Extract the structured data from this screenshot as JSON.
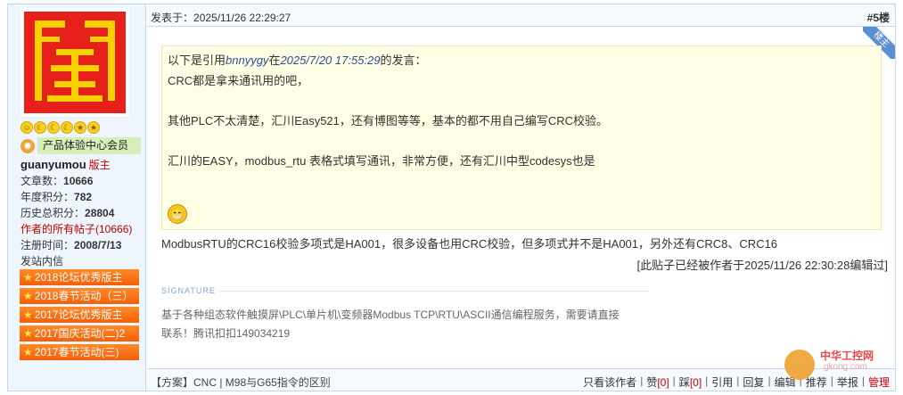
{
  "post": {
    "date_prefix": "发表于：",
    "date": "2025/11/26 22:29:27",
    "floor": "#5楼",
    "op_badge": "楼主"
  },
  "user": {
    "avatar_glyph": "闢",
    "stars": [
      "☺",
      "☾",
      "☾",
      "☾",
      "★",
      "★"
    ],
    "rank_label": "产品体验中心会员",
    "username": "guanyumou",
    "role": "版主",
    "stats": [
      {
        "label": "文章数：",
        "value": "10666"
      },
      {
        "label": "年度积分：",
        "value": "782"
      },
      {
        "label": "历史总积分：",
        "value": "28804"
      }
    ],
    "all_posts": "作者的所有帖子(10666)",
    "register_label": "注册时间：",
    "register_date": "2008/7/13",
    "msg_label": "发站内信",
    "medals": [
      "2018论坛优秀版主",
      "2018春节活动（三）",
      "2017论坛优秀版主",
      "2017国庆活动(二)2",
      "2017春节活动(三)"
    ]
  },
  "quote": {
    "prefix": "以下是引用",
    "author": "bnnyygy",
    "at": "在",
    "time": "2025/7/20 17:55:29",
    "suffix": "的发言：",
    "lines": [
      "CRC都是拿来通讯用的吧，",
      "其他PLC不太清楚，汇川Easy521，还有博图等等，基本的都不用自己编写CRC校验。",
      "汇川的EASY，modbus_rtu 表格式填写通讯，非常方便，还有汇川中型codesys也是"
    ],
    "emoji": "grin-emoji"
  },
  "body": {
    "text": "ModbusRTU的CRC16校验多项式是HA001，很多设备也用CRC校验，但多项式并不是HA001，另外还有CRC8、CRC16",
    "edited": "[此贴子已经被作者于2025/11/26 22:30:28编辑过]"
  },
  "signature": {
    "label": "SIGNATURE",
    "line1": "基于各种组态软件触摸屏\\PLC\\单片机\\变频器Modbus TCP\\RTU\\ASCII通信编程服务，需要请直接",
    "line2": "联系！腾讯扣扣149034219"
  },
  "footer": {
    "thread": "【方案】CNC | M98与G65指令的区别",
    "only_author": "只看该作者",
    "like": "赞",
    "like_count": "[0]",
    "dislike": "踩",
    "dislike_count": "[0]",
    "quote": "引用",
    "reply": "回复",
    "edit": "编辑",
    "recommend": "推荐",
    "report": "举报",
    "manage": "管理"
  },
  "watermark": {
    "title": "中华工控网",
    "domain": "gkong.com"
  }
}
